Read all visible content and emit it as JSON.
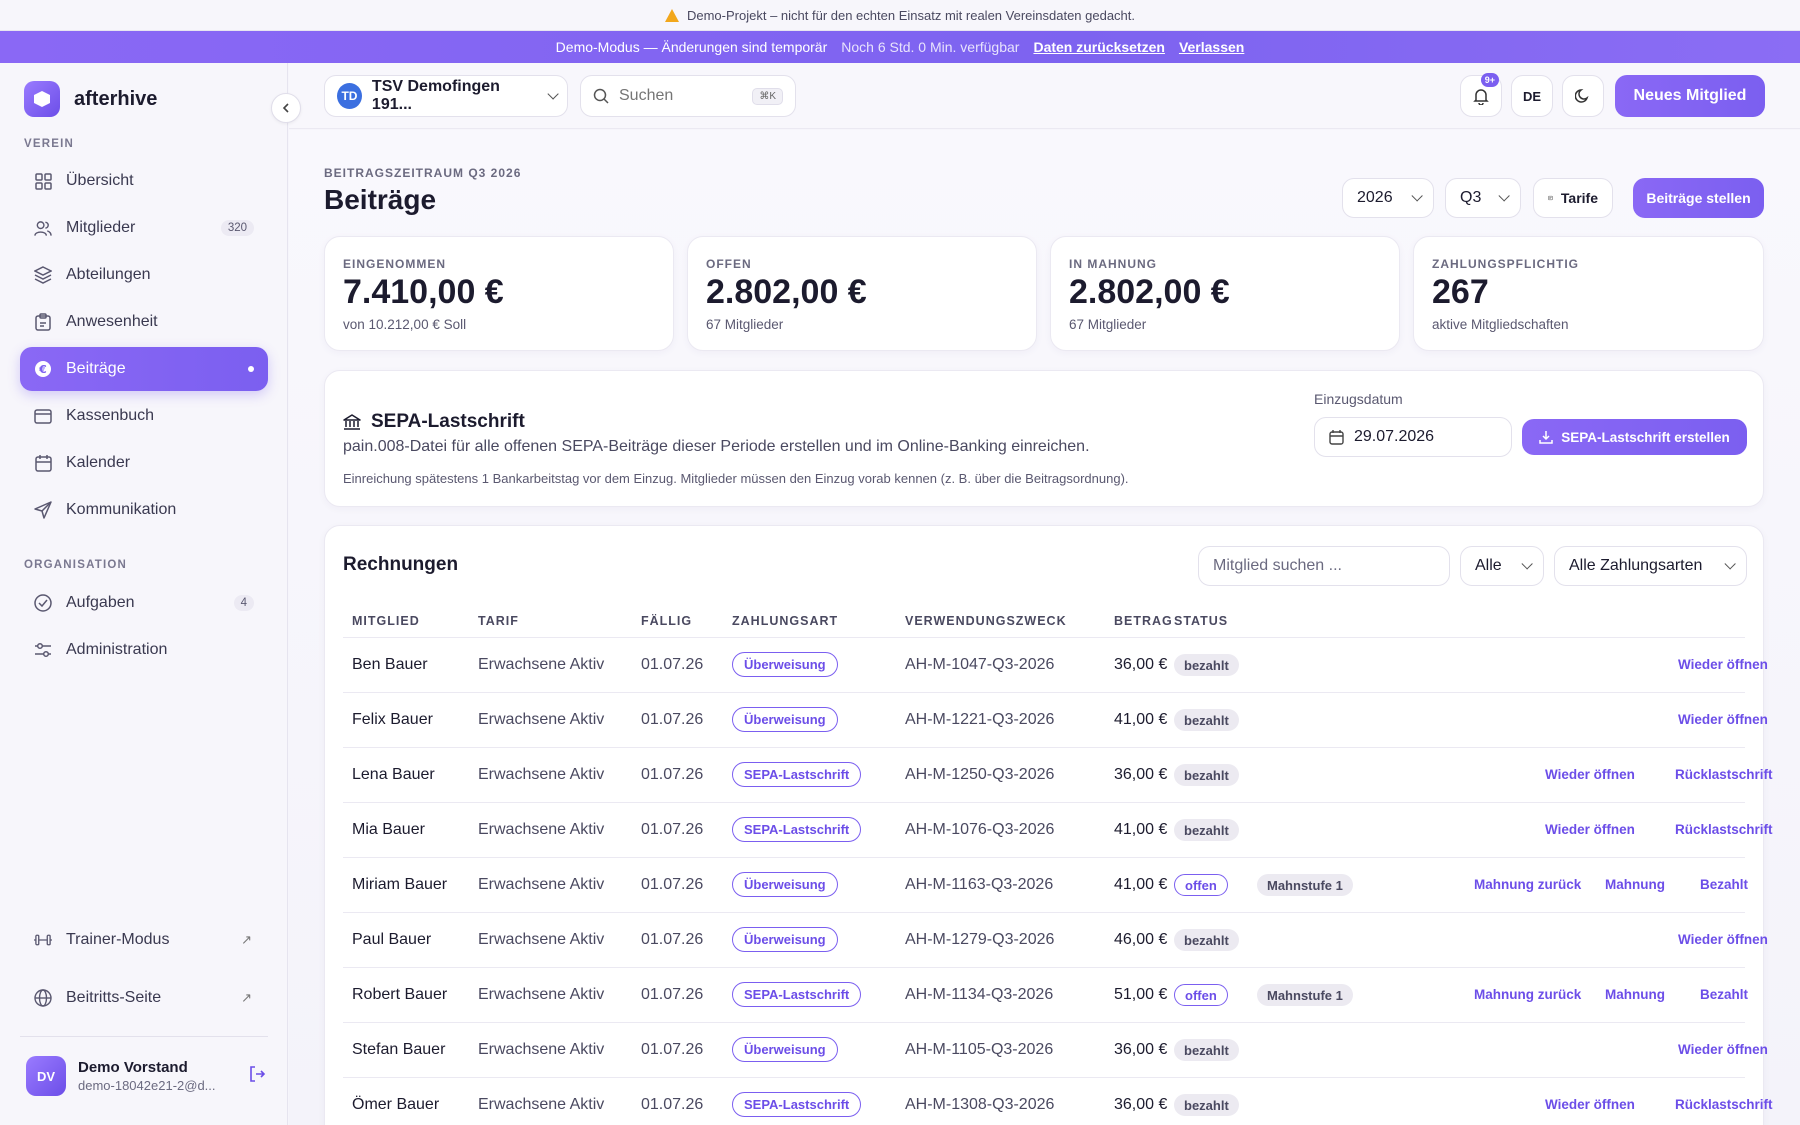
{
  "banner": {
    "warning": "Demo-Projekt – nicht für den echten Einsatz mit realen Vereinsdaten gedacht.",
    "demo_mode": "Demo-Modus — Änderungen sind temporär",
    "remaining": "Noch 6 Std. 0 Min. verfügbar",
    "reset_link": "Daten zurücksetzen",
    "leave_link": "Verlassen"
  },
  "sidebar": {
    "brand": "afterhive",
    "section_verein": "VEREIN",
    "section_organisation": "ORGANISATION",
    "items": [
      {
        "label": "Übersicht"
      },
      {
        "label": "Mitglieder",
        "badge": "320"
      },
      {
        "label": "Abteilungen"
      },
      {
        "label": "Anwesenheit"
      },
      {
        "label": "Beiträge"
      },
      {
        "label": "Kassenbuch"
      },
      {
        "label": "Kalender"
      },
      {
        "label": "Kommunikation"
      }
    ],
    "org_items": [
      {
        "label": "Aufgaben",
        "badge": "4"
      },
      {
        "label": "Administration"
      }
    ],
    "bottom_items": [
      {
        "label": "Trainer-Modus"
      },
      {
        "label": "Beitritts-Seite"
      }
    ],
    "user": {
      "initials": "DV",
      "name": "Demo Vorstand",
      "email": "demo-18042e21-2@d..."
    }
  },
  "topbar": {
    "org_initials": "TD",
    "org_name": "TSV Demofingen 191...",
    "search_placeholder": "Suchen",
    "search_kbd": "⌘K",
    "notif_badge": "9+",
    "lang": "DE",
    "new_member": "Neues Mitglied"
  },
  "page": {
    "period_label": "BEITRAGSZEITRAUM Q3 2026",
    "title": "Beiträge",
    "year": "2026",
    "quarter": "Q3",
    "tarife_btn": "Tarife",
    "create_btn": "Beiträge stellen"
  },
  "kpis": [
    {
      "label": "EINGENOMMEN",
      "value": "7.410,00 €",
      "sub": "von 10.212,00 € Soll"
    },
    {
      "label": "OFFEN",
      "value": "2.802,00 €",
      "sub": "67 Mitglieder"
    },
    {
      "label": "IN MAHNUNG",
      "value": "2.802,00 €",
      "sub": "67 Mitglieder"
    },
    {
      "label": "ZAHLUNGSPFLICHTIG",
      "value": "267",
      "sub": "aktive Mitgliedschaften"
    }
  ],
  "sepa": {
    "title": "SEPA-Lastschrift",
    "description": "pain.008-Datei für alle offenen SEPA-Beiträge dieser Periode erstellen und im Online-Banking einreichen.",
    "note": "Einreichung spätestens 1 Bankarbeitstag vor dem Einzug. Mitglieder müssen den Einzug vorab kennen (z. B. über die Beitragsordnung).",
    "date_label": "Einzugsdatum",
    "date_value": "29.07.2026",
    "button": "SEPA-Lastschrift erstellen"
  },
  "invoices": {
    "title": "Rechnungen",
    "search_placeholder": "Mitglied suchen ...",
    "filter_status": "Alle",
    "filter_payment": "Alle Zahlungsarten",
    "columns": [
      "MITGLIED",
      "TARIF",
      "FÄLLIG",
      "ZAHLUNGSART",
      "VERWENDUNGSZWECK",
      "BETRAG",
      "STATUS"
    ],
    "rows": [
      {
        "name": "Ben Bauer",
        "tarif": "Erwachsene Aktiv",
        "due": "01.07.26",
        "pay": "Überweisung",
        "ref": "AH-M-1047-Q3-2026",
        "amount": "36,00 €",
        "status": "bezahlt",
        "dunning": "",
        "actions": [
          "Wieder öffnen"
        ]
      },
      {
        "name": "Felix Bauer",
        "tarif": "Erwachsene Aktiv",
        "due": "01.07.26",
        "pay": "Überweisung",
        "ref": "AH-M-1221-Q3-2026",
        "amount": "41,00 €",
        "status": "bezahlt",
        "dunning": "",
        "actions": [
          "Wieder öffnen"
        ]
      },
      {
        "name": "Lena Bauer",
        "tarif": "Erwachsene Aktiv",
        "due": "01.07.26",
        "pay": "SEPA-Lastschrift",
        "ref": "AH-M-1250-Q3-2026",
        "amount": "36,00 €",
        "status": "bezahlt",
        "dunning": "",
        "actions": [
          "Wieder öffnen",
          "Rücklastschrift"
        ]
      },
      {
        "name": "Mia Bauer",
        "tarif": "Erwachsene Aktiv",
        "due": "01.07.26",
        "pay": "SEPA-Lastschrift",
        "ref": "AH-M-1076-Q3-2026",
        "amount": "41,00 €",
        "status": "bezahlt",
        "dunning": "",
        "actions": [
          "Wieder öffnen",
          "Rücklastschrift"
        ]
      },
      {
        "name": "Miriam Bauer",
        "tarif": "Erwachsene Aktiv",
        "due": "01.07.26",
        "pay": "Überweisung",
        "ref": "AH-M-1163-Q3-2026",
        "amount": "41,00 €",
        "status": "offen",
        "dunning": "Mahnstufe 1",
        "actions": [
          "Mahnung zurück",
          "Mahnung",
          "Bezahlt"
        ]
      },
      {
        "name": "Paul Bauer",
        "tarif": "Erwachsene Aktiv",
        "due": "01.07.26",
        "pay": "Überweisung",
        "ref": "AH-M-1279-Q3-2026",
        "amount": "46,00 €",
        "status": "bezahlt",
        "dunning": "",
        "actions": [
          "Wieder öffnen"
        ]
      },
      {
        "name": "Robert Bauer",
        "tarif": "Erwachsene Aktiv",
        "due": "01.07.26",
        "pay": "SEPA-Lastschrift",
        "ref": "AH-M-1134-Q3-2026",
        "amount": "51,00 €",
        "status": "offen",
        "dunning": "Mahnstufe 1",
        "actions": [
          "Mahnung zurück",
          "Mahnung",
          "Bezahlt"
        ]
      },
      {
        "name": "Stefan Bauer",
        "tarif": "Erwachsene Aktiv",
        "due": "01.07.26",
        "pay": "Überweisung",
        "ref": "AH-M-1105-Q3-2026",
        "amount": "36,00 €",
        "status": "bezahlt",
        "dunning": "",
        "actions": [
          "Wieder öffnen"
        ]
      },
      {
        "name": "Ömer Bauer",
        "tarif": "Erwachsene Aktiv",
        "due": "01.07.26",
        "pay": "SEPA-Lastschrift",
        "ref": "AH-M-1308-Q3-2026",
        "amount": "36,00 €",
        "status": "bezahlt",
        "dunning": "",
        "actions": [
          "Wieder öffnen",
          "Rücklastschrift"
        ]
      }
    ]
  }
}
